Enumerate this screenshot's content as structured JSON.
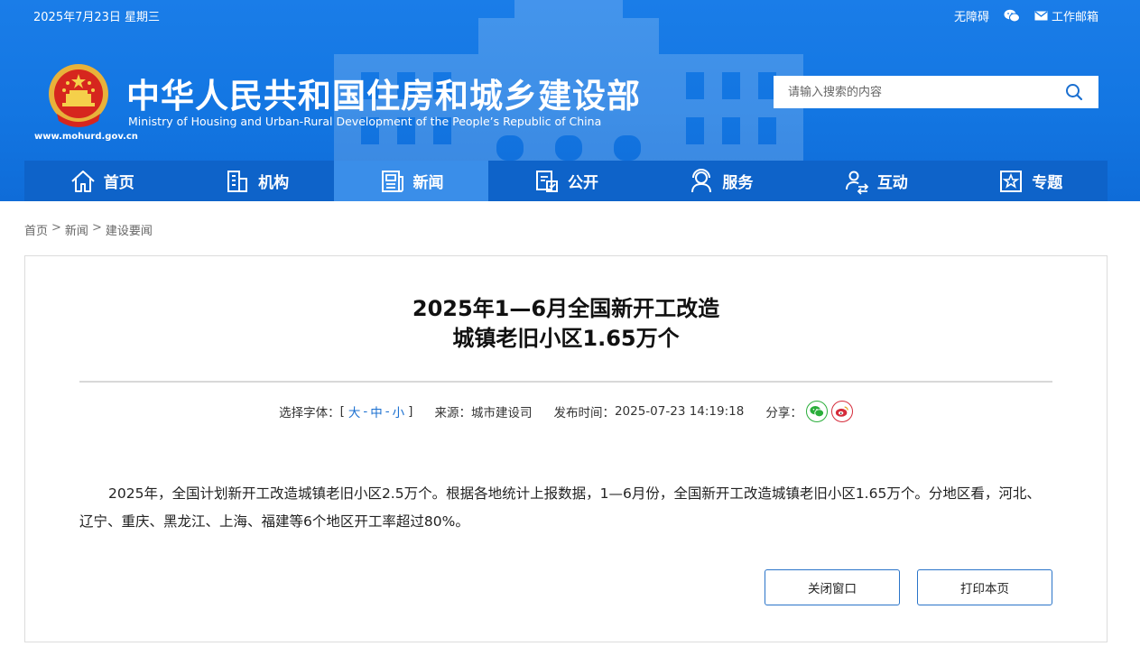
{
  "topbar": {
    "date": "2025年7月23日 星期三",
    "accessibility": "无障碍",
    "mail": "工作邮箱"
  },
  "site": {
    "title": "中华人民共和国住房和城乡建设部",
    "subtitle": "Ministry of Housing and Urban-Rural Development of the People’s Republic of China",
    "url": "www.mohurd.gov.cn"
  },
  "search": {
    "placeholder": "请输入搜索的内容"
  },
  "nav": {
    "items": [
      {
        "label": "首页",
        "icon": "home-icon"
      },
      {
        "label": "机构",
        "icon": "building-icon"
      },
      {
        "label": "新闻",
        "icon": "news-icon"
      },
      {
        "label": "公开",
        "icon": "open-icon"
      },
      {
        "label": "服务",
        "icon": "service-icon"
      },
      {
        "label": "互动",
        "icon": "interact-icon"
      },
      {
        "label": "专题",
        "icon": "topic-icon"
      }
    ],
    "active_index": 2
  },
  "breadcrumb": {
    "items": [
      "首页",
      "新闻",
      "建设要闻"
    ],
    "separator": ">"
  },
  "article": {
    "title_line1": "2025年1—6月全国新开工改造",
    "title_line2": "城镇老旧小区1.65万个",
    "font_label": "选择字体：",
    "font_open": "[",
    "font_large": "大",
    "font_medium": "中",
    "font_small": "小",
    "font_close": "]",
    "font_dash": "-",
    "source_label": "来源：",
    "source": "城市建设司",
    "time_label": "发布时间：",
    "time": "2025-07-23 14:19:18",
    "share_label": "分享：",
    "body": "2025年，全国计划新开工改造城镇老旧小区2.5万个。根据各地统计上报数据，1—6月份，全国新开工改造城镇老旧小区1.65万个。分地区看，河北、辽宁、重庆、黑龙江、上海、福建等6个地区开工率超过80%。"
  },
  "buttons": {
    "close": "关闭窗口",
    "print": "打印本页"
  },
  "colors": {
    "header_blue": "#1376e2",
    "nav_blue": "#0e63c9",
    "nav_active": "#3a8ee9",
    "link_blue": "#1a6fd0",
    "wechat_green": "#2aae3a",
    "weibo_red": "#d52b3a"
  }
}
